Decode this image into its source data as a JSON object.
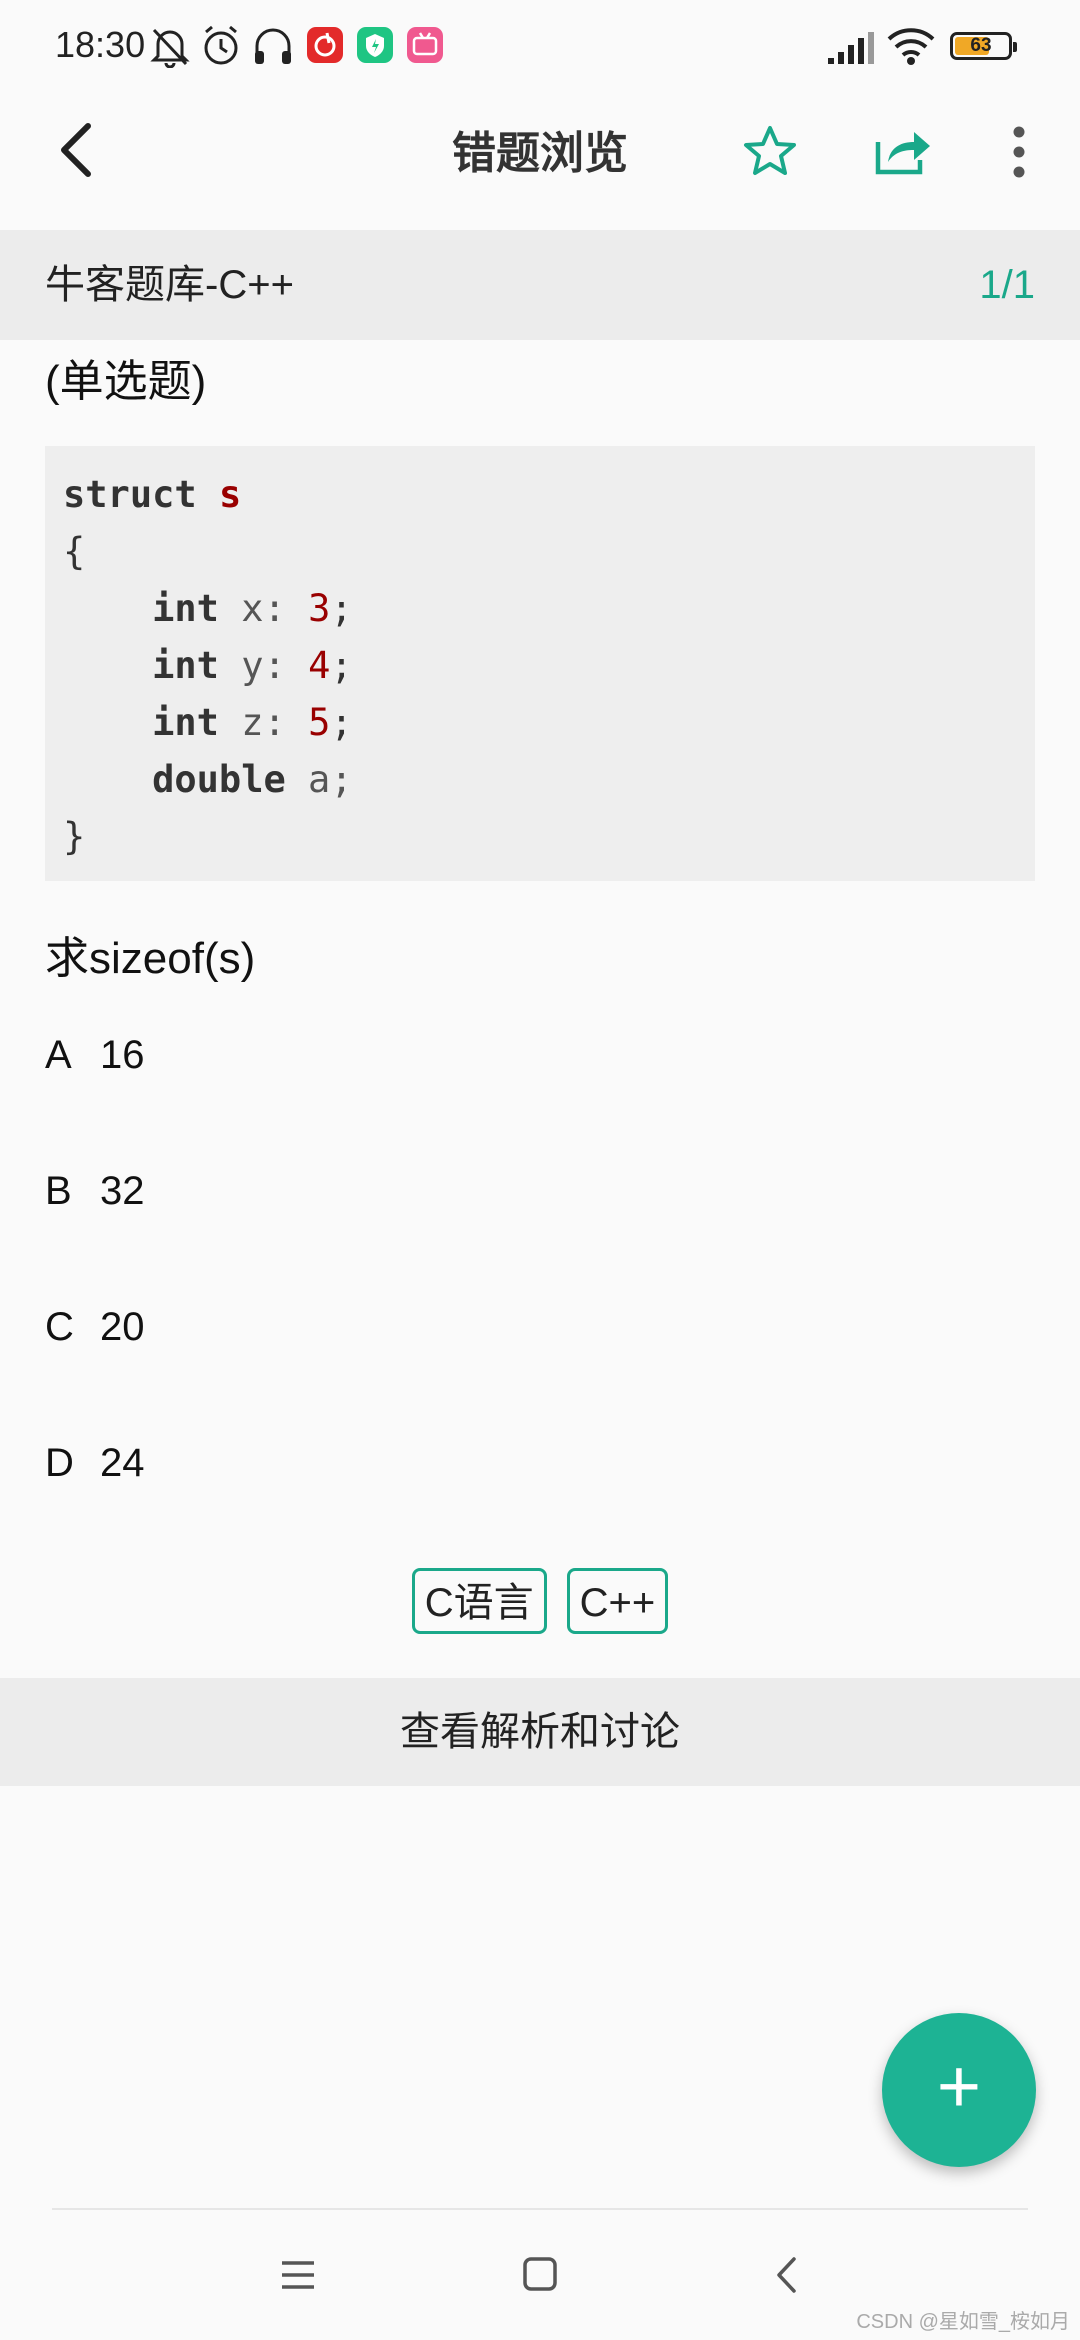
{
  "status_bar": {
    "time": "18:30",
    "battery": "63",
    "icons": [
      "bell-off-icon",
      "alarm-icon",
      "headphones-icon",
      "netease-music-icon",
      "security-app-icon",
      "bilibili-icon",
      "signal-icon",
      "wifi-icon",
      "battery-icon"
    ]
  },
  "appbar": {
    "title": "错题浏览",
    "accent": "#1aa88a",
    "icons": [
      "back-arrow-icon",
      "star-icon",
      "share-icon",
      "more-vert-icon"
    ]
  },
  "subheader": {
    "source": "牛客题库-C++",
    "page": "1/1"
  },
  "question": {
    "type": "(单选题)",
    "code": {
      "l1_kw": "struct",
      "l1_name": "s",
      "l2": "{",
      "l3_kw": "int",
      "l3_var": "x:",
      "l3_num": "3",
      "l4_kw": "int",
      "l4_var": "y:",
      "l4_num": "4",
      "l5_kw": "int",
      "l5_var": "z:",
      "l5_num": "5",
      "l6_kw": "double",
      "l6_var": "a;",
      "l7": "}"
    },
    "text": "求sizeof(s)",
    "options": [
      {
        "letter": "A",
        "text": "16"
      },
      {
        "letter": "B",
        "text": "32"
      },
      {
        "letter": "C",
        "text": "20"
      },
      {
        "letter": "D",
        "text": "24"
      }
    ],
    "tags": [
      "C语言",
      "C++"
    ]
  },
  "analysis_label": "查看解析和讨论",
  "fab_label": "+",
  "navbar": {
    "icons": [
      "menu-icon",
      "home-square-icon",
      "back-chevron-icon"
    ]
  },
  "watermark": "CSDN @星如雪_桉如月"
}
